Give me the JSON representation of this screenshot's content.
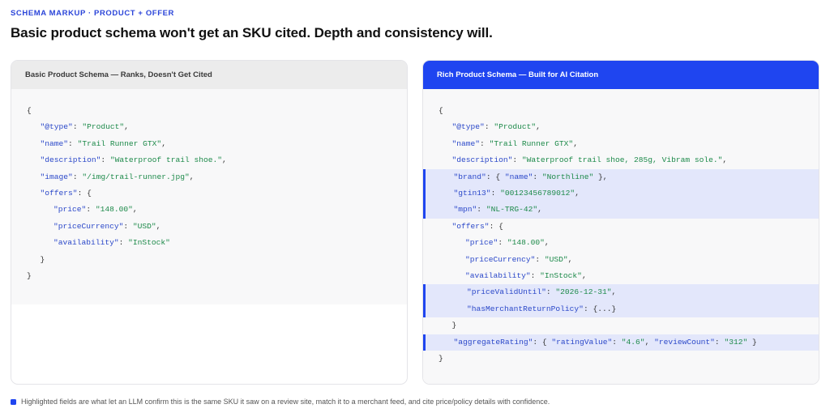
{
  "eyebrow": "SCHEMA MARKUP · PRODUCT + OFFER",
  "headline": "Basic product schema won't get an SKU cited. Depth and consistency will.",
  "colors": {
    "accent": "#1f45f0",
    "key": "#2b48c9",
    "string": "#1d8a4a",
    "highlight": "#e3e7fb"
  },
  "left_panel": {
    "title": "Basic Product Schema — Ranks, Doesn't Get Cited",
    "lines": [
      {
        "indent": 0,
        "parts": [
          [
            "p",
            "{"
          ]
        ]
      },
      {
        "indent": 1,
        "parts": [
          [
            "k",
            "\"@type\""
          ],
          [
            "p",
            ": "
          ],
          [
            "s",
            "\"Product\""
          ],
          [
            "p",
            ","
          ]
        ]
      },
      {
        "indent": 1,
        "parts": [
          [
            "k",
            "\"name\""
          ],
          [
            "p",
            ": "
          ],
          [
            "s",
            "\"Trail Runner GTX\""
          ],
          [
            "p",
            ","
          ]
        ]
      },
      {
        "indent": 1,
        "parts": [
          [
            "k",
            "\"description\""
          ],
          [
            "p",
            ": "
          ],
          [
            "s",
            "\"Waterproof trail shoe.\""
          ],
          [
            "p",
            ","
          ]
        ]
      },
      {
        "indent": 1,
        "parts": [
          [
            "k",
            "\"image\""
          ],
          [
            "p",
            ": "
          ],
          [
            "s",
            "\"/img/trail-runner.jpg\""
          ],
          [
            "p",
            ","
          ]
        ]
      },
      {
        "indent": 1,
        "parts": [
          [
            "k",
            "\"offers\""
          ],
          [
            "p",
            ": {"
          ]
        ]
      },
      {
        "indent": 2,
        "parts": [
          [
            "k",
            "\"price\""
          ],
          [
            "p",
            ": "
          ],
          [
            "s",
            "\"148.00\""
          ],
          [
            "p",
            ","
          ]
        ]
      },
      {
        "indent": 2,
        "parts": [
          [
            "k",
            "\"priceCurrency\""
          ],
          [
            "p",
            ": "
          ],
          [
            "s",
            "\"USD\""
          ],
          [
            "p",
            ","
          ]
        ]
      },
      {
        "indent": 2,
        "parts": [
          [
            "k",
            "\"availability\""
          ],
          [
            "p",
            ": "
          ],
          [
            "s",
            "\"InStock\""
          ]
        ]
      },
      {
        "indent": 1,
        "parts": [
          [
            "p",
            "}"
          ]
        ]
      },
      {
        "indent": 0,
        "parts": [
          [
            "p",
            "}"
          ]
        ]
      }
    ]
  },
  "right_panel": {
    "title": "Rich Product Schema — Built for AI Citation",
    "lines": [
      {
        "indent": 0,
        "hl": false,
        "parts": [
          [
            "p",
            "{"
          ]
        ]
      },
      {
        "indent": 1,
        "hl": false,
        "parts": [
          [
            "k",
            "\"@type\""
          ],
          [
            "p",
            ": "
          ],
          [
            "s",
            "\"Product\""
          ],
          [
            "p",
            ","
          ]
        ]
      },
      {
        "indent": 1,
        "hl": false,
        "parts": [
          [
            "k",
            "\"name\""
          ],
          [
            "p",
            ": "
          ],
          [
            "s",
            "\"Trail Runner GTX\""
          ],
          [
            "p",
            ","
          ]
        ]
      },
      {
        "indent": 1,
        "hl": false,
        "parts": [
          [
            "k",
            "\"description\""
          ],
          [
            "p",
            ": "
          ],
          [
            "s",
            "\"Waterproof trail shoe, 285g, Vibram sole.\""
          ],
          [
            "p",
            ","
          ]
        ]
      },
      {
        "indent": 1,
        "hl": true,
        "parts": [
          [
            "k",
            "\"brand\""
          ],
          [
            "p",
            ": { "
          ],
          [
            "k",
            "\"name\""
          ],
          [
            "p",
            ": "
          ],
          [
            "s",
            "\"Northline\""
          ],
          [
            "p",
            " },"
          ]
        ]
      },
      {
        "indent": 1,
        "hl": true,
        "parts": [
          [
            "k",
            "\"gtin13\""
          ],
          [
            "p",
            ": "
          ],
          [
            "s",
            "\"00123456789012\""
          ],
          [
            "p",
            ","
          ]
        ]
      },
      {
        "indent": 1,
        "hl": true,
        "parts": [
          [
            "k",
            "\"mpn\""
          ],
          [
            "p",
            ": "
          ],
          [
            "s",
            "\"NL-TRG-42\""
          ],
          [
            "p",
            ","
          ]
        ]
      },
      {
        "indent": 1,
        "hl": false,
        "parts": [
          [
            "k",
            "\"offers\""
          ],
          [
            "p",
            ": {"
          ]
        ]
      },
      {
        "indent": 2,
        "hl": false,
        "parts": [
          [
            "k",
            "\"price\""
          ],
          [
            "p",
            ": "
          ],
          [
            "s",
            "\"148.00\""
          ],
          [
            "p",
            ","
          ]
        ]
      },
      {
        "indent": 2,
        "hl": false,
        "parts": [
          [
            "k",
            "\"priceCurrency\""
          ],
          [
            "p",
            ": "
          ],
          [
            "s",
            "\"USD\""
          ],
          [
            "p",
            ","
          ]
        ]
      },
      {
        "indent": 2,
        "hl": false,
        "parts": [
          [
            "k",
            "\"availability\""
          ],
          [
            "p",
            ": "
          ],
          [
            "s",
            "\"InStock\""
          ],
          [
            "p",
            ","
          ]
        ]
      },
      {
        "indent": 2,
        "hl": true,
        "parts": [
          [
            "k",
            "\"priceValidUntil\""
          ],
          [
            "p",
            ": "
          ],
          [
            "s",
            "\"2026-12-31\""
          ],
          [
            "p",
            ","
          ]
        ]
      },
      {
        "indent": 2,
        "hl": true,
        "parts": [
          [
            "k",
            "\"hasMerchantReturnPolicy\""
          ],
          [
            "p",
            ": {...}"
          ]
        ]
      },
      {
        "indent": 1,
        "hl": false,
        "parts": [
          [
            "p",
            "}"
          ]
        ]
      },
      {
        "indent": 1,
        "hl": true,
        "parts": [
          [
            "k",
            "\"aggregateRating\""
          ],
          [
            "p",
            ": { "
          ],
          [
            "k",
            "\"ratingValue\""
          ],
          [
            "p",
            ": "
          ],
          [
            "s",
            "\"4.6\""
          ],
          [
            "p",
            ", "
          ],
          [
            "k",
            "\"reviewCount\""
          ],
          [
            "p",
            ": "
          ],
          [
            "s",
            "\"312\""
          ],
          [
            "p",
            " }"
          ]
        ]
      },
      {
        "indent": 0,
        "hl": false,
        "parts": [
          [
            "p",
            "}"
          ]
        ]
      }
    ]
  },
  "footnote": "Highlighted fields are what let an LLM confirm this is the same SKU it saw on a review site, match it to a merchant feed, and cite price/policy details with confidence."
}
